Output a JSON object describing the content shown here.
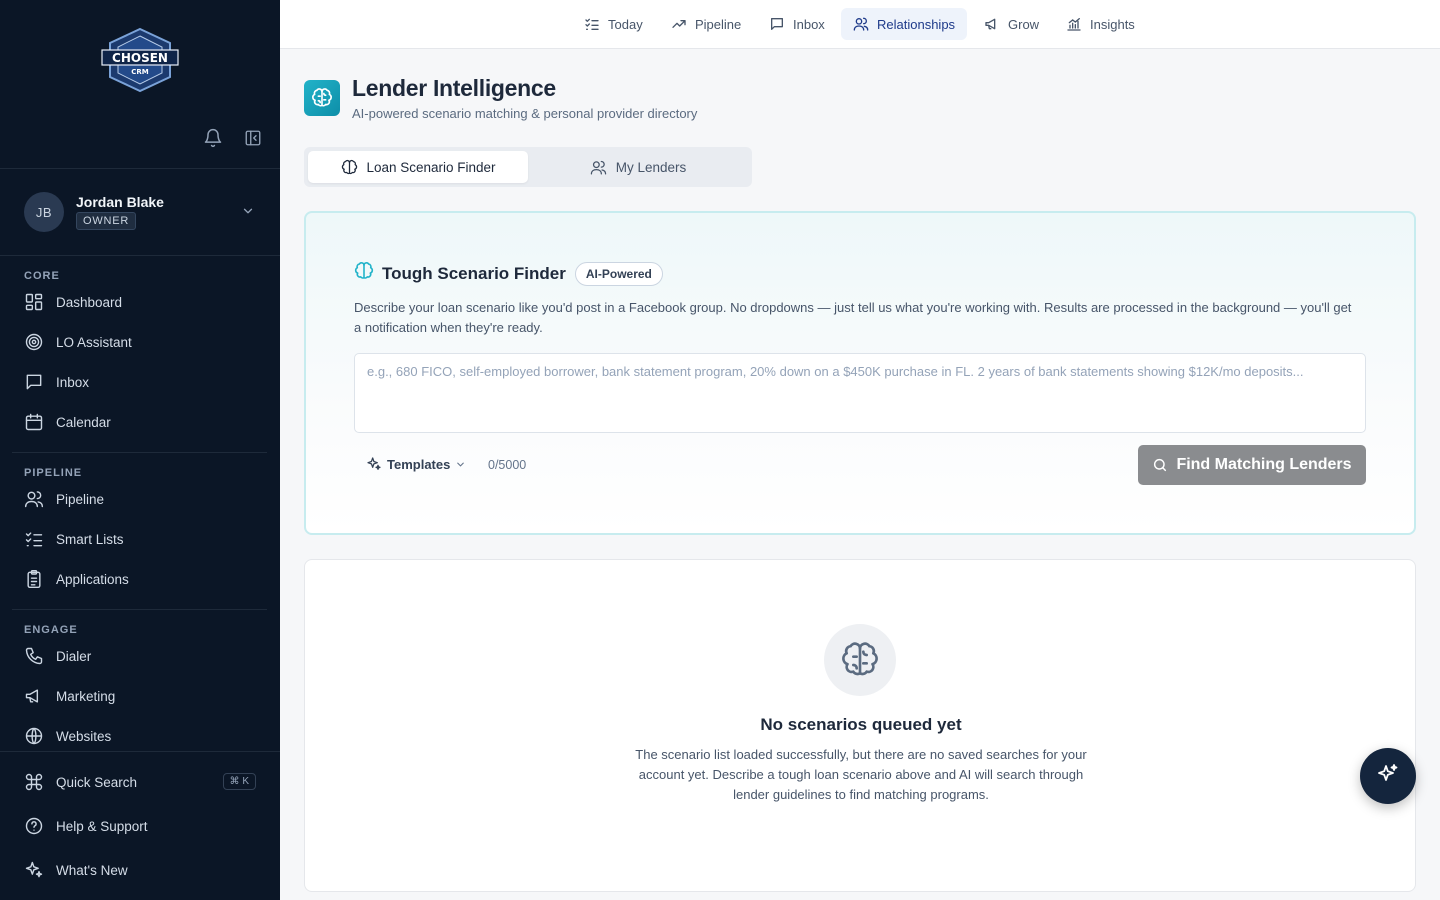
{
  "brand": {
    "logo_text": "CHOSEN",
    "logo_subtext": "CRM"
  },
  "user": {
    "initials": "JB",
    "name": "Jordan Blake",
    "role": "OWNER"
  },
  "sidebar": {
    "sections": [
      {
        "label": "CORE",
        "items": [
          {
            "label": "Dashboard",
            "icon": "dashboard-icon"
          },
          {
            "label": "LO Assistant",
            "icon": "target-icon"
          },
          {
            "label": "Inbox",
            "icon": "message-icon"
          },
          {
            "label": "Calendar",
            "icon": "calendar-icon"
          }
        ]
      },
      {
        "label": "PIPELINE",
        "items": [
          {
            "label": "Pipeline",
            "icon": "users-icon"
          },
          {
            "label": "Smart Lists",
            "icon": "list-checks-icon"
          },
          {
            "label": "Applications",
            "icon": "clipboard-icon"
          }
        ]
      },
      {
        "label": "ENGAGE",
        "items": [
          {
            "label": "Dialer",
            "icon": "phone-icon"
          },
          {
            "label": "Marketing",
            "icon": "megaphone-icon"
          },
          {
            "label": "Websites",
            "icon": "globe-icon"
          }
        ]
      }
    ],
    "footer": [
      {
        "label": "Quick Search",
        "icon": "command-icon",
        "shortcut": "⌘ K"
      },
      {
        "label": "Help & Support",
        "icon": "help-circle-icon"
      },
      {
        "label": "What's New",
        "icon": "sparkles-icon"
      }
    ]
  },
  "topnav": {
    "tabs": [
      {
        "label": "Today",
        "icon": "list-checks-icon"
      },
      {
        "label": "Pipeline",
        "icon": "trending-up-icon"
      },
      {
        "label": "Inbox",
        "icon": "message-icon"
      },
      {
        "label": "Relationships",
        "icon": "users-icon",
        "active": true
      },
      {
        "label": "Grow",
        "icon": "megaphone-icon"
      },
      {
        "label": "Insights",
        "icon": "bar-chart-icon"
      }
    ]
  },
  "header": {
    "title": "Lender Intelligence",
    "subtitle": "AI-powered scenario matching & personal provider directory"
  },
  "segments": [
    {
      "label": "Loan Scenario Finder",
      "active": true
    },
    {
      "label": "My Lenders",
      "active": false
    }
  ],
  "finder": {
    "title": "Tough Scenario Finder",
    "badge": "AI-Powered",
    "description": "Describe your loan scenario like you'd post in a Facebook group. No dropdowns — just tell us what you're working with. Results are processed in the background — you'll get a notification when they're ready.",
    "input_value": "",
    "input_placeholder": "e.g., 680 FICO, self-employed borrower, bank statement program, 20% down on a $450K purchase in FL. 2 years of bank statements showing $12K/mo deposits...",
    "templates_label": "Templates",
    "counter": "0/5000",
    "submit_label": "Find Matching Lenders"
  },
  "empty_state": {
    "title": "No scenarios queued yet",
    "description": "The scenario list loaded successfully, but there are no saved searches for your account yet. Describe a tough loan scenario above and AI will search through lender guidelines to find matching programs."
  },
  "colors": {
    "sidebar_bg": "#0b1626",
    "accent_teal": "#22b3c9",
    "active_tab_bg": "#eef3fb",
    "active_tab_text": "#1e3a8a",
    "submit_disabled": "#8a8c8f",
    "fab_bg": "#14253d"
  }
}
